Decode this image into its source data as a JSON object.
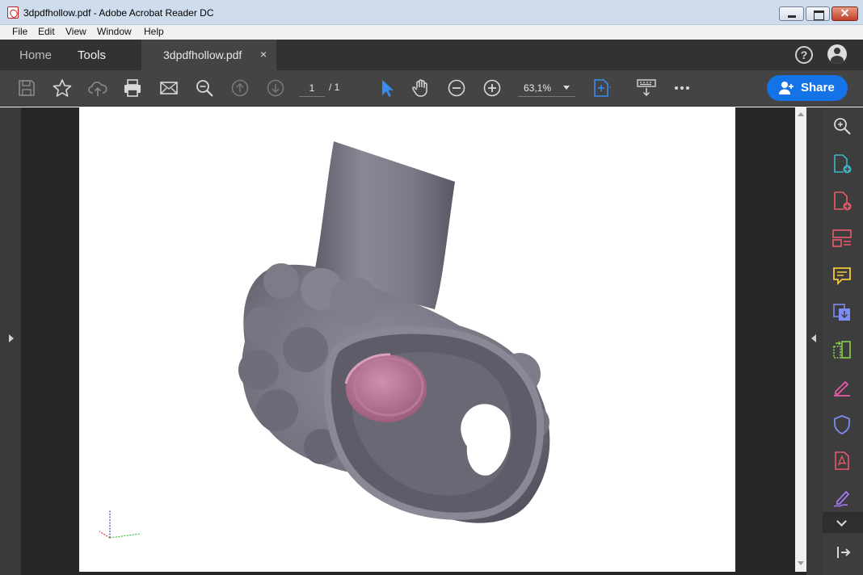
{
  "window": {
    "title": "3dpdfhollow.pdf - Adobe Acrobat Reader DC",
    "close_glyph": "✕"
  },
  "menu": {
    "items": [
      "File",
      "Edit",
      "View",
      "Window",
      "Help"
    ]
  },
  "tabs": {
    "home": "Home",
    "tools": "Tools",
    "document": "3dpdfhollow.pdf",
    "close_glyph": "×"
  },
  "header_icons": {
    "help": "?",
    "account": "account-icon"
  },
  "toolbar": {
    "page_current": "1",
    "page_total": "/ 1",
    "zoom": "63,1%",
    "share_label": "Share",
    "icons": [
      "save-icon",
      "star-icon",
      "cloud-upload-icon",
      "print-icon",
      "email-icon",
      "search-zoom-icon",
      "page-up-icon",
      "page-down-icon",
      "select-cursor-icon",
      "hand-icon",
      "zoom-out-icon",
      "zoom-in-icon",
      "fit-page-icon",
      "keyboard-icon",
      "more-icon"
    ]
  },
  "tools_pane": {
    "icons": [
      "search-zoom-icon",
      "create-pdf-icon",
      "export-pdf-icon",
      "organize-pages-icon",
      "comment-icon",
      "combine-files-icon",
      "compress-icon",
      "fill-sign-icon",
      "protect-icon",
      "adobe-sign-icon",
      "signature-icon"
    ]
  },
  "colors": {
    "accent": "#1473e6",
    "model_grey": "#7d7b86",
    "model_pink": "#b87897"
  }
}
